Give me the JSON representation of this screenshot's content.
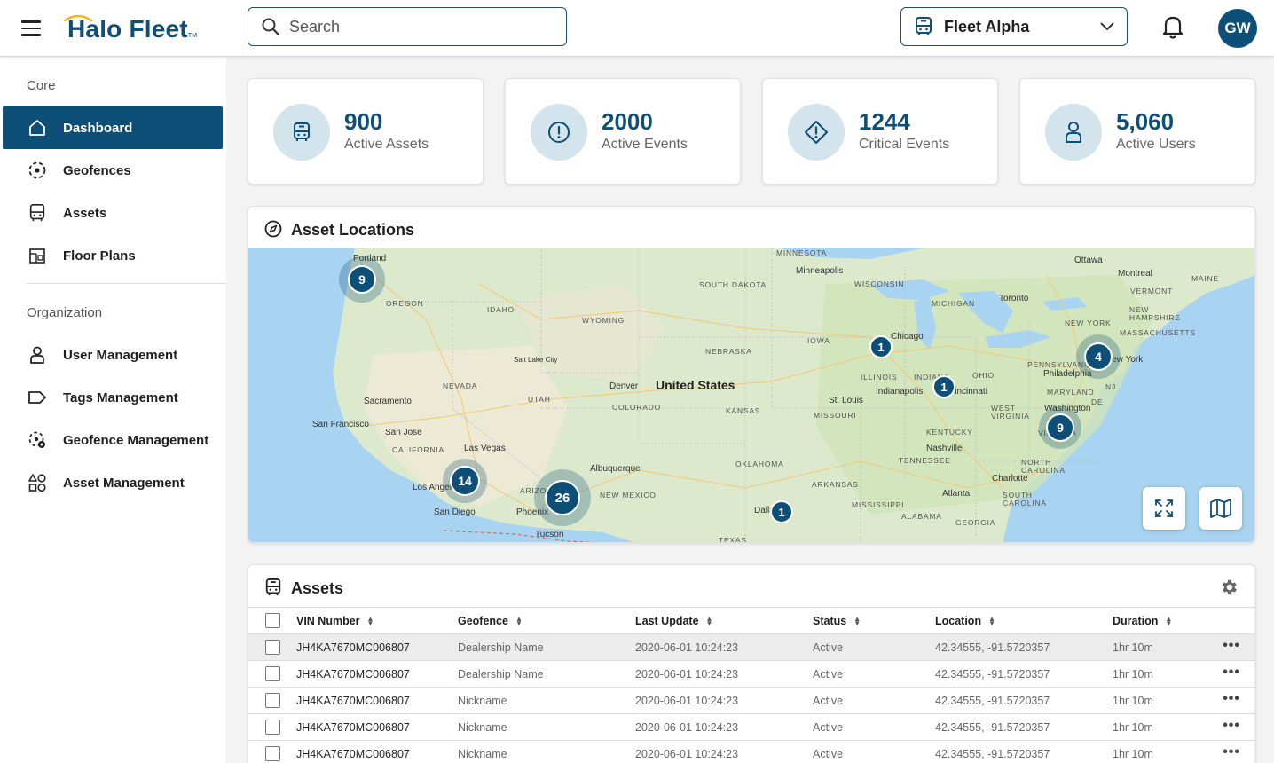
{
  "header": {
    "logo_text": "Halo Fleet",
    "logo_tm": "TM",
    "search_placeholder": "Search",
    "fleet_selected": "Fleet Alpha",
    "avatar_initials": "GW"
  },
  "sidebar": {
    "core_title": "Core",
    "core_items": [
      {
        "label": "Dashboard",
        "icon": "home-icon"
      },
      {
        "label": "Geofences",
        "icon": "geofence-icon"
      },
      {
        "label": "Assets",
        "icon": "bus-icon"
      },
      {
        "label": "Floor Plans",
        "icon": "floor-plan-icon"
      }
    ],
    "org_title": "Organization",
    "org_items": [
      {
        "label": "User Management",
        "icon": "user-icon"
      },
      {
        "label": "Tags Management",
        "icon": "tag-icon"
      },
      {
        "label": "Geofence Management",
        "icon": "geofence-gear-icon"
      },
      {
        "label": "Asset Management",
        "icon": "shapes-icon"
      }
    ]
  },
  "stats": [
    {
      "value": "900",
      "label": "Active Assets",
      "icon": "bus-icon"
    },
    {
      "value": "2000",
      "label": "Active Events",
      "icon": "alert-circle-icon"
    },
    {
      "value": "1244",
      "label": "Critical Events",
      "icon": "alert-diamond-icon"
    },
    {
      "value": "5,060",
      "label": "Active Users",
      "icon": "user-icon"
    }
  ],
  "map": {
    "title": "Asset Locations",
    "clusters": [
      "9",
      "1",
      "1",
      "4",
      "9",
      "14",
      "26",
      "1"
    ],
    "labels": {
      "country": "United States",
      "cities": [
        "Portland",
        "Minneapolis",
        "Ottawa",
        "Montreal",
        "Toronto",
        "Chicago",
        "Salt Lake City",
        "Denver",
        "Sacramento",
        "San Francisco",
        "San Jose",
        "Las Vegas",
        "Los Angeles",
        "San Diego",
        "Phoenix",
        "Tucson",
        "Albuquerque",
        "Dallas",
        "St. Louis",
        "Indianapolis",
        "Cincinnati",
        "Nashville",
        "Atlanta",
        "Charlotte",
        "Philadelphia",
        "New York",
        "Washington"
      ],
      "states": [
        "MINNESOTA",
        "SOUTH DAKOTA",
        "WISCONSIN",
        "MICHIGAN",
        "OREGON",
        "IDAHO",
        "WYOMING",
        "NEBRASKA",
        "IOWA",
        "ILLINOIS",
        "INDIANA",
        "OHIO",
        "NEVADA",
        "UTAH",
        "COLORADO",
        "KANSAS",
        "MISSOURI",
        "KENTUCKY",
        "CALIFORNIA",
        "ARIZONA",
        "NEW MEXICO",
        "OKLAHOMA",
        "ARKANSAS",
        "TENNESSEE",
        "MISSISSIPPI",
        "ALABAMA",
        "GEORGIA",
        "TEXAS",
        "NORTH CAROLINA",
        "SOUTH CAROLINA",
        "WEST VIRGINIA",
        "VIRGINIA",
        "PENNSYLVANIA",
        "MARYLAND",
        "DE",
        "NJ",
        "NEW YORK",
        "VERMONT",
        "NEW HAMPSHIRE",
        "MASSACHUSETTS",
        "MAINE"
      ]
    }
  },
  "assets": {
    "title": "Assets",
    "columns": [
      "VIN Number",
      "Geofence",
      "Last Update",
      "Status",
      "Location",
      "Duration"
    ],
    "rows": [
      [
        "JH4KA7670MC006807",
        "Dealership Name",
        "2020-06-01 10:24:23",
        "Active",
        "42.34555, -91.5720357",
        "1hr 10m"
      ],
      [
        "JH4KA7670MC006807",
        "Dealership Name",
        "2020-06-01 10:24:23",
        "Active",
        "42.34555, -91.5720357",
        "1hr 10m"
      ],
      [
        "JH4KA7670MC006807",
        "Nickname",
        "2020-06-01 10:24:23",
        "Active",
        "42.34555, -91.5720357",
        "1hr 10m"
      ],
      [
        "JH4KA7670MC006807",
        "Nickname",
        "2020-06-01 10:24:23",
        "Active",
        "42.34555, -91.5720357",
        "1hr 10m"
      ],
      [
        "JH4KA7670MC006807",
        "Nickname",
        "2020-06-01 10:24:23",
        "Active",
        "42.34555, -91.5720357",
        "1hr 10m"
      ]
    ]
  },
  "colors": {
    "brand": "#0e4f78",
    "accent_light": "#d3e4ec",
    "map_water": "#a8d3f1",
    "map_land": "#e8efdd"
  }
}
